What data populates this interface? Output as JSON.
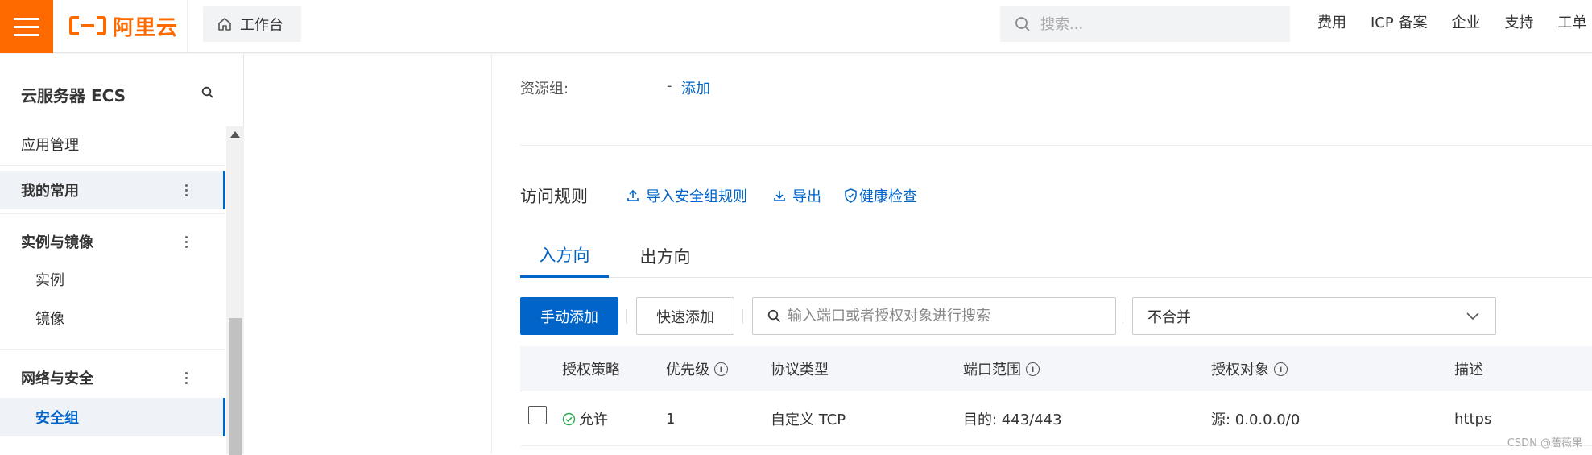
{
  "header": {
    "logo_text": "阿里云",
    "workbench_label": "工作台",
    "search_placeholder": "搜索...",
    "nav": [
      "费用",
      "ICP 备案",
      "企业",
      "支持",
      "工单"
    ]
  },
  "sidebar": {
    "title": "云服务器 ECS",
    "items": {
      "app_mgmt": "应用管理",
      "favorites": "我的常用",
      "instances_group": "实例与镜像",
      "instances": "实例",
      "images": "镜像",
      "network_group": "网络与安全",
      "security_group": "安全组"
    }
  },
  "resource_group": {
    "label": "资源组:",
    "value": "-",
    "add_link": "添加"
  },
  "rules": {
    "title": "访问规则",
    "import_link": "导入安全组规则",
    "export_link": "导出",
    "health_link": "健康检查"
  },
  "tabs": [
    "入方向",
    "出方向"
  ],
  "toolbar": {
    "manual_add": "手动添加",
    "quick_add": "快速添加",
    "search_placeholder": "输入端口或者授权对象进行搜索",
    "merge_value": "不合并"
  },
  "table": {
    "columns": [
      "授权策略",
      "优先级",
      "协议类型",
      "端口范围",
      "授权对象",
      "描述"
    ],
    "rows": [
      {
        "policy": "允许",
        "priority": "1",
        "protocol": "自定义 TCP",
        "port": "目的: 443/443",
        "source": "源: 0.0.0.0/0",
        "desc": "https"
      }
    ]
  },
  "watermark": "CSDN @蔷薇果",
  "colors": {
    "brand": "#ff6a00",
    "accent": "#0064c8",
    "success": "#2fa84f"
  }
}
